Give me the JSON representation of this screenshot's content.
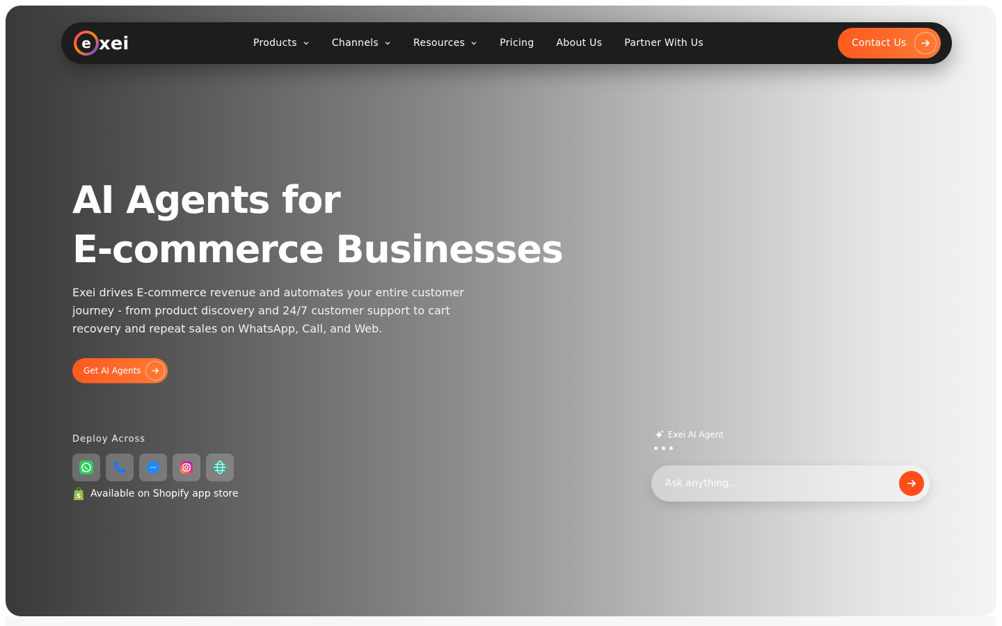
{
  "nav": {
    "logo_text": "exei",
    "items": [
      {
        "label": "Products",
        "has_dropdown": true
      },
      {
        "label": "Channels",
        "has_dropdown": true
      },
      {
        "label": "Resources",
        "has_dropdown": true
      },
      {
        "label": "Pricing",
        "has_dropdown": false
      },
      {
        "label": "About Us",
        "has_dropdown": false
      },
      {
        "label": "Partner With Us",
        "has_dropdown": false
      }
    ],
    "contact_label": "Contact Us"
  },
  "hero": {
    "headline_line1": "AI Agents for",
    "headline_line2": "E-commerce Businesses",
    "description": "Exei drives E-commerce revenue and automates your entire customer journey - from product discovery and 24/7 customer support to cart recovery and repeat sales on WhatsApp, Call, and Web.",
    "cta_label": "Get AI Agents",
    "deploy_label": "Deploy Across",
    "channels": [
      "whatsapp-icon",
      "phone-icon",
      "messenger-icon",
      "instagram-icon",
      "globe-icon"
    ],
    "shopify_text": "Available on Shopify app store"
  },
  "agent_widget": {
    "label": "Exei AI Agent",
    "placeholder": "Ask anything..."
  },
  "colors": {
    "accent": "#ff5a1f",
    "nav_bg": "#1d1d1d"
  }
}
